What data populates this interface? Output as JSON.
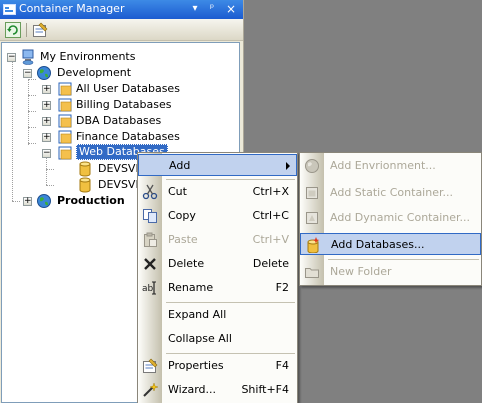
{
  "panel": {
    "title": "Container Manager",
    "buttons": {
      "dropdown": "▾",
      "pin": "ᵖ",
      "close": "×"
    },
    "toolbar": {
      "refresh_icon": "refresh-icon",
      "properties_icon": "properties-icon"
    }
  },
  "tree": {
    "root": {
      "label": "My Environments"
    },
    "development": {
      "label": "Development"
    },
    "items": [
      {
        "label": "All User Databases"
      },
      {
        "label": "Billing Databases"
      },
      {
        "label": "DBA Databases"
      },
      {
        "label": "Finance Databases"
      },
      {
        "label": "Web Databases"
      }
    ],
    "children": [
      {
        "label": "DEVSVI"
      },
      {
        "label": "DEVSVI"
      }
    ],
    "production": {
      "label": "Production"
    }
  },
  "context_menu": {
    "items": [
      {
        "label": "Add",
        "shortcut": ""
      },
      {
        "label": "Cut",
        "shortcut": "Ctrl+X"
      },
      {
        "label": "Copy",
        "shortcut": "Ctrl+C"
      },
      {
        "label": "Paste",
        "shortcut": "Ctrl+V"
      },
      {
        "label": "Delete",
        "shortcut": "Delete"
      },
      {
        "label": "Rename",
        "shortcut": "F2"
      },
      {
        "label": "Expand All",
        "shortcut": ""
      },
      {
        "label": "Collapse All",
        "shortcut": ""
      },
      {
        "label": "Properties",
        "shortcut": "F4"
      },
      {
        "label": "Wizard...",
        "shortcut": "Shift+F4"
      }
    ]
  },
  "submenu": {
    "items": [
      {
        "label": "Add Envrionment..."
      },
      {
        "label": "Add Static Container..."
      },
      {
        "label": "Add Dynamic Container..."
      },
      {
        "label": "Add Databases..."
      },
      {
        "label": "New Folder"
      }
    ]
  },
  "colors": {
    "title_gradient_top": "#3d8ae6",
    "selection": "#316ac5",
    "menu_highlight": "#c1d2ee"
  }
}
